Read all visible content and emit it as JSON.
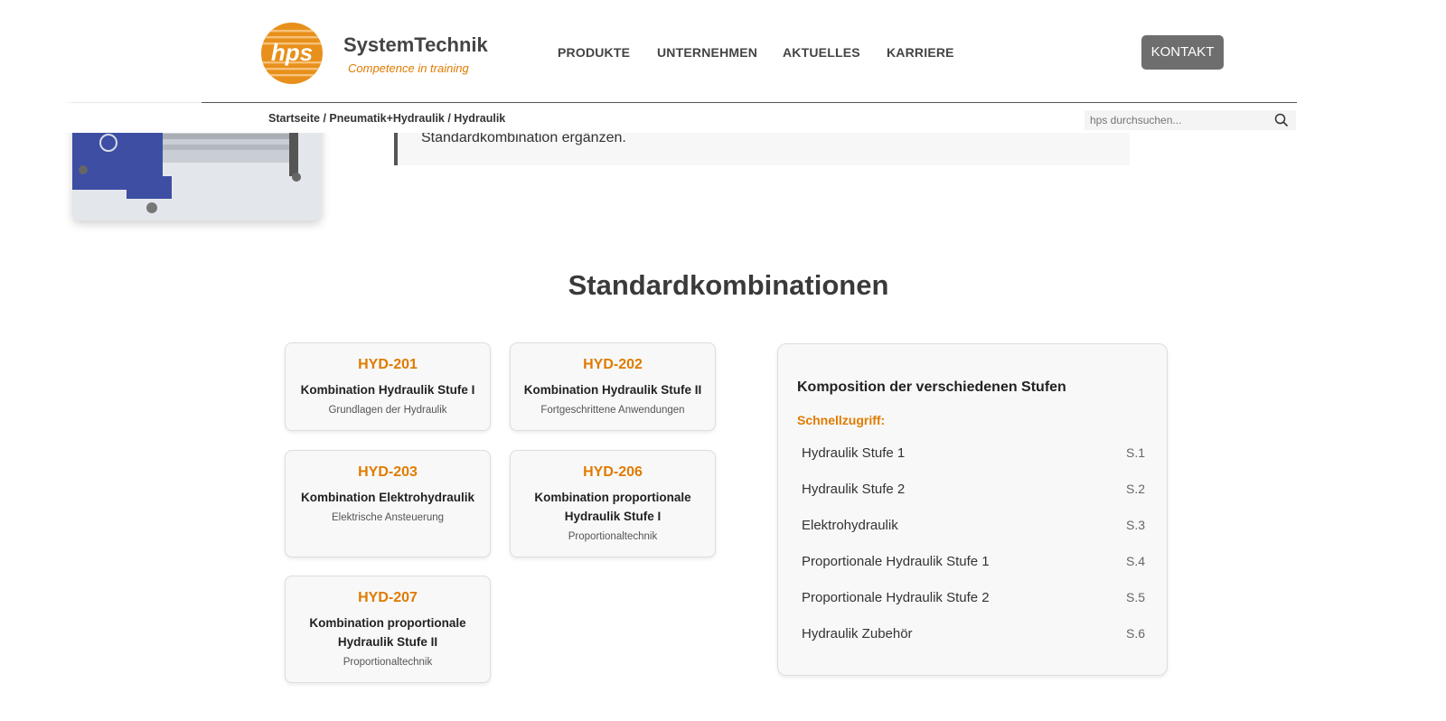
{
  "header": {
    "brand": "SystemTechnik",
    "tagline": "Competence in training",
    "logo_text": "hps",
    "nav": [
      "PRODUKTE",
      "UNTERNEHMEN",
      "AKTUELLES",
      "KARRIERE"
    ],
    "contact_label": "KONTAKT"
  },
  "subbar": {
    "breadcrumb": "Startseite / Pneumatik+Hydraulik / Hydraulik",
    "search_placeholder": "hps durchsuchen..."
  },
  "intro": {
    "text": "Standardkombination ergänzen."
  },
  "section": {
    "title": "Standardkombinationen"
  },
  "cards": [
    {
      "code": "HYD-201",
      "name": "Kombination Hydraulik Stufe I",
      "desc": "Grundlagen der Hydraulik"
    },
    {
      "code": "HYD-202",
      "name": "Kombination Hydraulik Stufe II",
      "desc": "Fortgeschrittene Anwendungen"
    },
    {
      "code": "HYD-203",
      "name": "Kombination Elektrohydraulik",
      "desc": "Elektrische Ansteuerung"
    },
    {
      "code": "HYD-206",
      "name": "Kombination proportionale Hydraulik Stufe I",
      "desc": "Proportionaltechnik"
    },
    {
      "code": "HYD-207",
      "name": "Kombination proportionale Hydraulik Stufe II",
      "desc": "Proportionaltechnik"
    }
  ],
  "quick_access": {
    "title": "Komposition der verschiedenen Stufen",
    "label": "Schnellzugriff:",
    "items": [
      {
        "label": "Hydraulik Stufe 1",
        "page": "S.1"
      },
      {
        "label": "Hydraulik Stufe 2",
        "page": "S.2"
      },
      {
        "label": "Elektrohydraulik",
        "page": "S.3"
      },
      {
        "label": "Proportionale Hydraulik Stufe 1",
        "page": "S.4"
      },
      {
        "label": "Proportionale Hydraulik Stufe 2",
        "page": "S.5"
      },
      {
        "label": "Hydraulik Zubehör",
        "page": "S.6"
      }
    ]
  },
  "colors": {
    "accent": "#e07b00",
    "contact_button": "#6e6e6e",
    "text": "#333333"
  },
  "icons": [
    "search-icon"
  ]
}
